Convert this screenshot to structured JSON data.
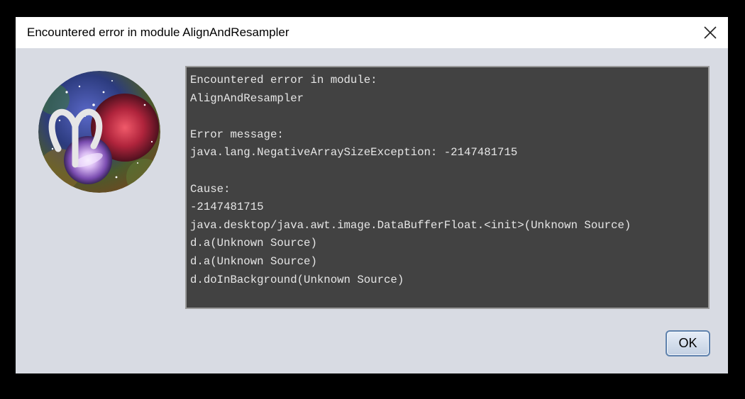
{
  "window": {
    "title": "Encountered error in module AlignAndResampler",
    "close_icon": "close-icon"
  },
  "logo": {
    "icon": "aries-nebula-logo",
    "colors": {
      "ring": "#e6e6e6",
      "nebula_red": "#b0243c",
      "galaxy_purple": "#a37bd6",
      "space_blue": "#3b4a9a"
    }
  },
  "log": {
    "lines": [
      "Encountered error in module:",
      "AlignAndResampler",
      "",
      "Error message:",
      "java.lang.NegativeArraySizeException: -2147481715",
      "",
      "Cause:",
      "-2147481715",
      "java.desktop/java.awt.image.DataBufferFloat.<init>(Unknown Source)",
      "d.a(Unknown Source)",
      "d.a(Unknown Source)",
      "d.doInBackground(Unknown Source)"
    ]
  },
  "buttons": {
    "ok_label": "OK"
  },
  "colors": {
    "dialog_bg": "#d8dbe3",
    "panel_bg": "#424242",
    "panel_text": "#e6e6e6",
    "ok_border": "#5f82ad"
  }
}
